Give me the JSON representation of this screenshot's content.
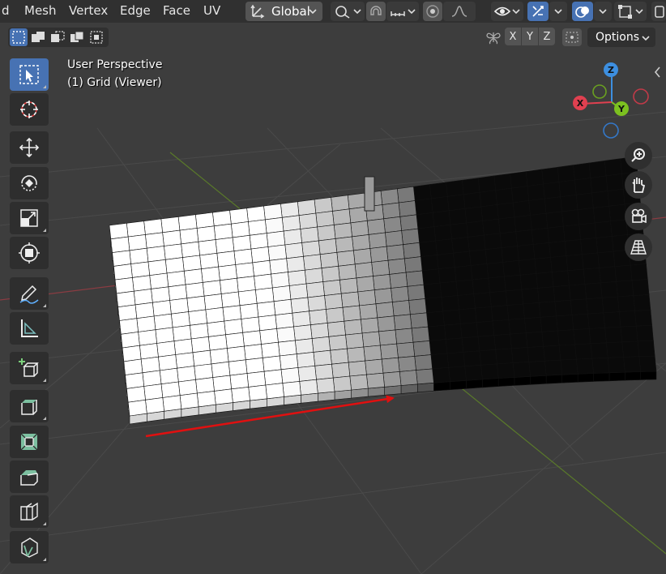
{
  "menubar": {
    "items": [
      "d",
      "Mesh",
      "Vertex",
      "Edge",
      "Face",
      "UV"
    ],
    "transform_orientation": "Global",
    "options_label": "Options"
  },
  "overlay": {
    "view_name": "User Perspective",
    "object_name": "(1) Grid (Viewer)"
  },
  "axes": {
    "x": "X",
    "y": "Y",
    "z": "Z"
  },
  "gizmo": {
    "x_label": "X",
    "y_label": "Y",
    "z_label": "Z"
  },
  "colors": {
    "menubar_bg": "#303030",
    "viewport_bg": "#3d3d3d",
    "active_tool": "#4772b3",
    "axis_x": "#e04050",
    "axis_y": "#7cc020",
    "axis_z": "#3d8fe0",
    "annotation_arrow": "#e01010"
  },
  "tools": [
    {
      "name": "select-box-tool",
      "icon": "select-cursor-icon",
      "active": true
    },
    {
      "name": "cursor-tool",
      "icon": "3d-cursor-icon",
      "active": false
    },
    {
      "name": "move-tool",
      "icon": "move-arrows-icon",
      "active": false
    },
    {
      "name": "rotate-tool",
      "icon": "rotate-icon",
      "active": false
    },
    {
      "name": "scale-tool",
      "icon": "scale-icon",
      "active": false
    },
    {
      "name": "transform-tool",
      "icon": "transform-icon",
      "active": false
    },
    {
      "name": "annotate-tool",
      "icon": "pencil-icon",
      "active": false
    },
    {
      "name": "measure-tool",
      "icon": "ruler-icon",
      "active": false
    },
    {
      "name": "add-cube-tool",
      "icon": "add-cube-icon",
      "active": false
    },
    {
      "name": "extrude-tool",
      "icon": "extrude-icon",
      "active": false
    },
    {
      "name": "inset-tool",
      "icon": "inset-icon",
      "active": false
    },
    {
      "name": "bevel-tool",
      "icon": "bevel-icon",
      "active": false
    },
    {
      "name": "loop-cut-tool",
      "icon": "loop-cut-icon",
      "active": false
    },
    {
      "name": "knife-tool",
      "icon": "knife-icon",
      "active": false
    }
  ]
}
